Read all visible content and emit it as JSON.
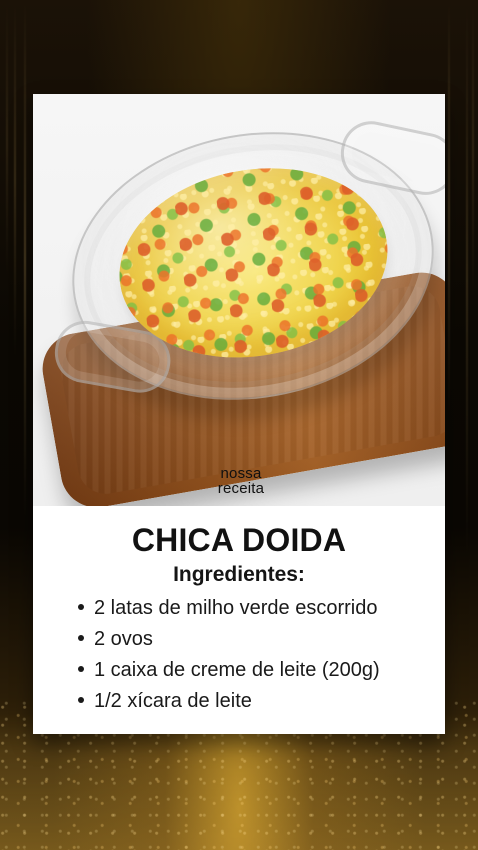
{
  "logo": {
    "line1": "nossa",
    "line2": "receita"
  },
  "recipe": {
    "title": "CHICA DOIDA",
    "ingredients_heading": "Ingredientes:",
    "ingredients": [
      "2 latas de milho verde escorrido",
      "2 ovos",
      "1 caixa de creme de leite (200g)",
      "1/2 xícara de leite"
    ]
  }
}
